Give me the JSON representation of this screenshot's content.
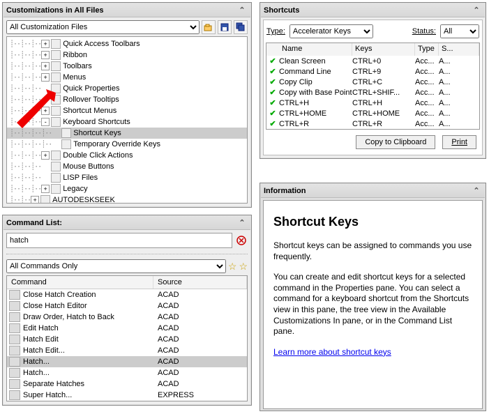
{
  "customizations": {
    "title": "Customizations in All Files",
    "combo": "All Customization Files",
    "tree": [
      {
        "level": 3,
        "exp": "+",
        "icon": "toolbar-icon",
        "label": "Quick Access Toolbars"
      },
      {
        "level": 3,
        "exp": "+",
        "icon": "ribbon-icon",
        "label": "Ribbon"
      },
      {
        "level": 3,
        "exp": "+",
        "icon": "toolbar-icon",
        "label": "Toolbars"
      },
      {
        "level": 3,
        "exp": "+",
        "icon": "menu-icon",
        "label": "Menus"
      },
      {
        "level": 3,
        "exp": "",
        "icon": "props-icon",
        "label": "Quick Properties"
      },
      {
        "level": 3,
        "exp": "",
        "icon": "tooltip-icon",
        "label": "Rollover Tooltips"
      },
      {
        "level": 3,
        "exp": "+",
        "icon": "shortcut-menu-icon",
        "label": "Shortcut Menus"
      },
      {
        "level": 3,
        "exp": "-",
        "icon": "keyboard-icon",
        "label": "Keyboard Shortcuts"
      },
      {
        "level": 4,
        "exp": "",
        "icon": "keys-icon",
        "label": "Shortcut Keys",
        "selected": true
      },
      {
        "level": 4,
        "exp": "",
        "icon": "override-icon",
        "label": "Temporary Override Keys"
      },
      {
        "level": 3,
        "exp": "+",
        "icon": "dblclick-icon",
        "label": "Double Click Actions"
      },
      {
        "level": 3,
        "exp": "",
        "icon": "mouse-icon",
        "label": "Mouse Buttons"
      },
      {
        "level": 3,
        "exp": "",
        "icon": "lisp-icon",
        "label": "LISP Files"
      },
      {
        "level": 3,
        "exp": "+",
        "icon": "legacy-icon",
        "label": "Legacy"
      },
      {
        "level": 2,
        "exp": "+",
        "icon": "cui-icon",
        "label": "AUTODESKSEEK"
      }
    ]
  },
  "commandList": {
    "title": "Command List:",
    "search_value": "hatch",
    "filter_combo": "All Commands Only",
    "columns": {
      "c1": "Command",
      "c2": "Source"
    },
    "rows": [
      {
        "icon": "x-icon",
        "name": "Close Hatch Creation",
        "source": "ACAD"
      },
      {
        "icon": "x-icon",
        "name": "Close Hatch Editor",
        "source": "ACAD"
      },
      {
        "icon": "draw-order-icon",
        "name": "Draw Order, Hatch to Back",
        "source": "ACAD"
      },
      {
        "icon": "edit-hatch-icon",
        "name": "Edit Hatch",
        "source": "ACAD"
      },
      {
        "icon": "edit-hatch-icon",
        "name": "Hatch Edit",
        "source": "ACAD"
      },
      {
        "icon": "edit-hatch-icon",
        "name": "Hatch Edit...",
        "source": "ACAD"
      },
      {
        "icon": "hatch-icon",
        "name": "Hatch...",
        "source": "ACAD",
        "selected": true
      },
      {
        "icon": "hatch-icon",
        "name": "Hatch...",
        "source": "ACAD"
      },
      {
        "icon": "blank-icon",
        "name": "Separate Hatches",
        "source": "ACAD"
      },
      {
        "icon": "super-hatch-icon",
        "name": "Super Hatch...",
        "source": "EXPRESS"
      }
    ]
  },
  "shortcuts": {
    "title": "Shortcuts",
    "type_label": "Type:",
    "type_value": "Accelerator Keys",
    "status_label": "Status:",
    "status_value": "All",
    "columns": {
      "name": "Name",
      "keys": "Keys",
      "type": "Type",
      "source": "S..."
    },
    "rows": [
      {
        "name": "Clean Screen",
        "keys": "CTRL+0",
        "type": "Acc...",
        "source": "A..."
      },
      {
        "name": "Command Line",
        "keys": "CTRL+9",
        "type": "Acc...",
        "source": "A..."
      },
      {
        "name": "Copy Clip",
        "keys": "CTRL+C",
        "type": "Acc...",
        "source": "A..."
      },
      {
        "name": "Copy with Base Point",
        "keys": "CTRL+SHIF...",
        "type": "Acc...",
        "source": "A..."
      },
      {
        "name": "CTRL+H",
        "keys": "CTRL+H",
        "type": "Acc...",
        "source": "A..."
      },
      {
        "name": "CTRL+HOME",
        "keys": "CTRL+HOME",
        "type": "Acc...",
        "source": "A..."
      },
      {
        "name": "CTRL+R",
        "keys": "CTRL+R",
        "type": "Acc...",
        "source": "A..."
      }
    ],
    "copy_button": "Copy to Clipboard",
    "print_button": "Print"
  },
  "information": {
    "title": "Information",
    "heading": "Shortcut Keys",
    "p1": "Shortcut keys can be assigned to commands you use frequently.",
    "p2": "You can create and edit shortcut keys for a selected command in the Properties pane. You can select a command for a keyboard shortcut from the Shortcuts view in this pane, the tree view in the Available Customizations In pane, or in the Command List pane.",
    "link": "Learn more about shortcut keys"
  }
}
